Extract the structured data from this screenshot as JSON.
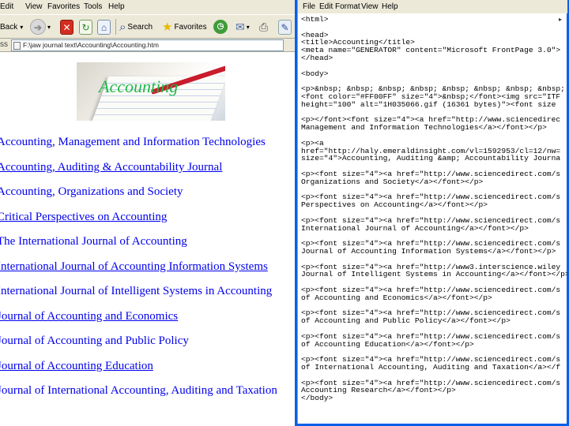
{
  "browser": {
    "menu": [
      "Edit",
      "View",
      "Favorites",
      "Tools",
      "Help"
    ],
    "toolbar": {
      "back_label": "Back",
      "search_label": "Search",
      "favorites_label": "Favorites"
    },
    "address": "F:\\jaw journal text\\Accounting\\Accounting.htm",
    "banner_text": "Accounting",
    "journals": [
      {
        "title": "Accounting, Management and Information Technologies",
        "underlined": false
      },
      {
        "title": "Accounting, Auditing & Accountability Journal",
        "underlined": true
      },
      {
        "title": "Accounting, Organizations and Society",
        "underlined": false
      },
      {
        "title": "Critical Perspectives on Accounting",
        "underlined": true
      },
      {
        "title": "The International Journal of Accounting",
        "underlined": false
      },
      {
        "title": "International Journal of Accounting Information Systems",
        "underlined": true
      },
      {
        "title": "International Journal of Intelligent Systems in Accounting",
        "underlined": false
      },
      {
        "title": "Journal of Accounting and Economics",
        "underlined": true
      },
      {
        "title": "Journal of Accounting and Public Policy",
        "underlined": false
      },
      {
        "title": "Journal of Accounting Education",
        "underlined": true
      },
      {
        "title": "Journal of International Accounting, Auditing and Taxation",
        "underlined": false
      }
    ]
  },
  "notepad": {
    "menu": [
      "File",
      "Edit",
      "Format",
      "View",
      "Help"
    ],
    "source_lines": [
      "<html>",
      "",
      "<head>",
      "<title>Accounting</title>",
      "<meta name=\"GENERATOR\" content=\"Microsoft FrontPage 3.0\">",
      "</head>",
      "",
      "<body>",
      "",
      "<p>&nbsp; &nbsp; &nbsp; &nbsp; &nbsp; &nbsp; &nbsp; &nbsp;",
      "<font color=\"#FF00FF\" size=\"4\">&nbsp;</font><img src=\"ITF",
      "height=\"100\" alt=\"1H035066.gif (16361 bytes)\"><font size",
      "",
      "<p></font><font size=\"4\"><a href=\"http://www.sciencedirec",
      "Management and Information Technologies</a></font></p>",
      "",
      "<p><a",
      "href=\"http://haly.emeraldinsight.com/vl=1592953/cl=12/nw=",
      "size=\"4\">Accounting, Auditing &amp; Accountability Journa",
      "",
      "<p><font size=\"4\"><a href=\"http://www.sciencedirect.com/s",
      "Organizations and Society</a></font></p>",
      "",
      "<p><font size=\"4\"><a href=\"http://www.sciencedirect.com/s",
      "Perspectives on Accounting</a></font></p>",
      "",
      "<p><font size=\"4\"><a href=\"http://www.sciencedirect.com/s",
      "International Journal of Accounting</a></font></p>",
      "",
      "<p><font size=\"4\"><a href=\"http://www.sciencedirect.com/s",
      "Journal of Accounting Information Systems</a></font></p>",
      "",
      "<p><font size=\"4\"><a href=\"http://www3.interscience.wiley",
      "Journal of Intelligent Systems in Accounting</a></font></p>",
      "",
      "<p><font size=\"4\"><a href=\"http://www.sciencedirect.com/s",
      "of Accounting and Economics</a></font></p>",
      "",
      "<p><font size=\"4\"><a href=\"http://www.sciencedirect.com/s",
      "of Accounting and Public Policy</a></font></p>",
      "",
      "<p><font size=\"4\"><a href=\"http://www.sciencedirect.com/s",
      "of Accounting Education</a></font></p>",
      "",
      "<p><font size=\"4\"><a href=\"http://www.sciencedirect.com/s",
      "of International Accounting, Auditing and Taxation</a></f",
      "",
      "<p><font size=\"4\"><a href=\"http://www.sciencedirect.com/s",
      "Accounting Research</a></font></p>",
      "</body>"
    ]
  }
}
